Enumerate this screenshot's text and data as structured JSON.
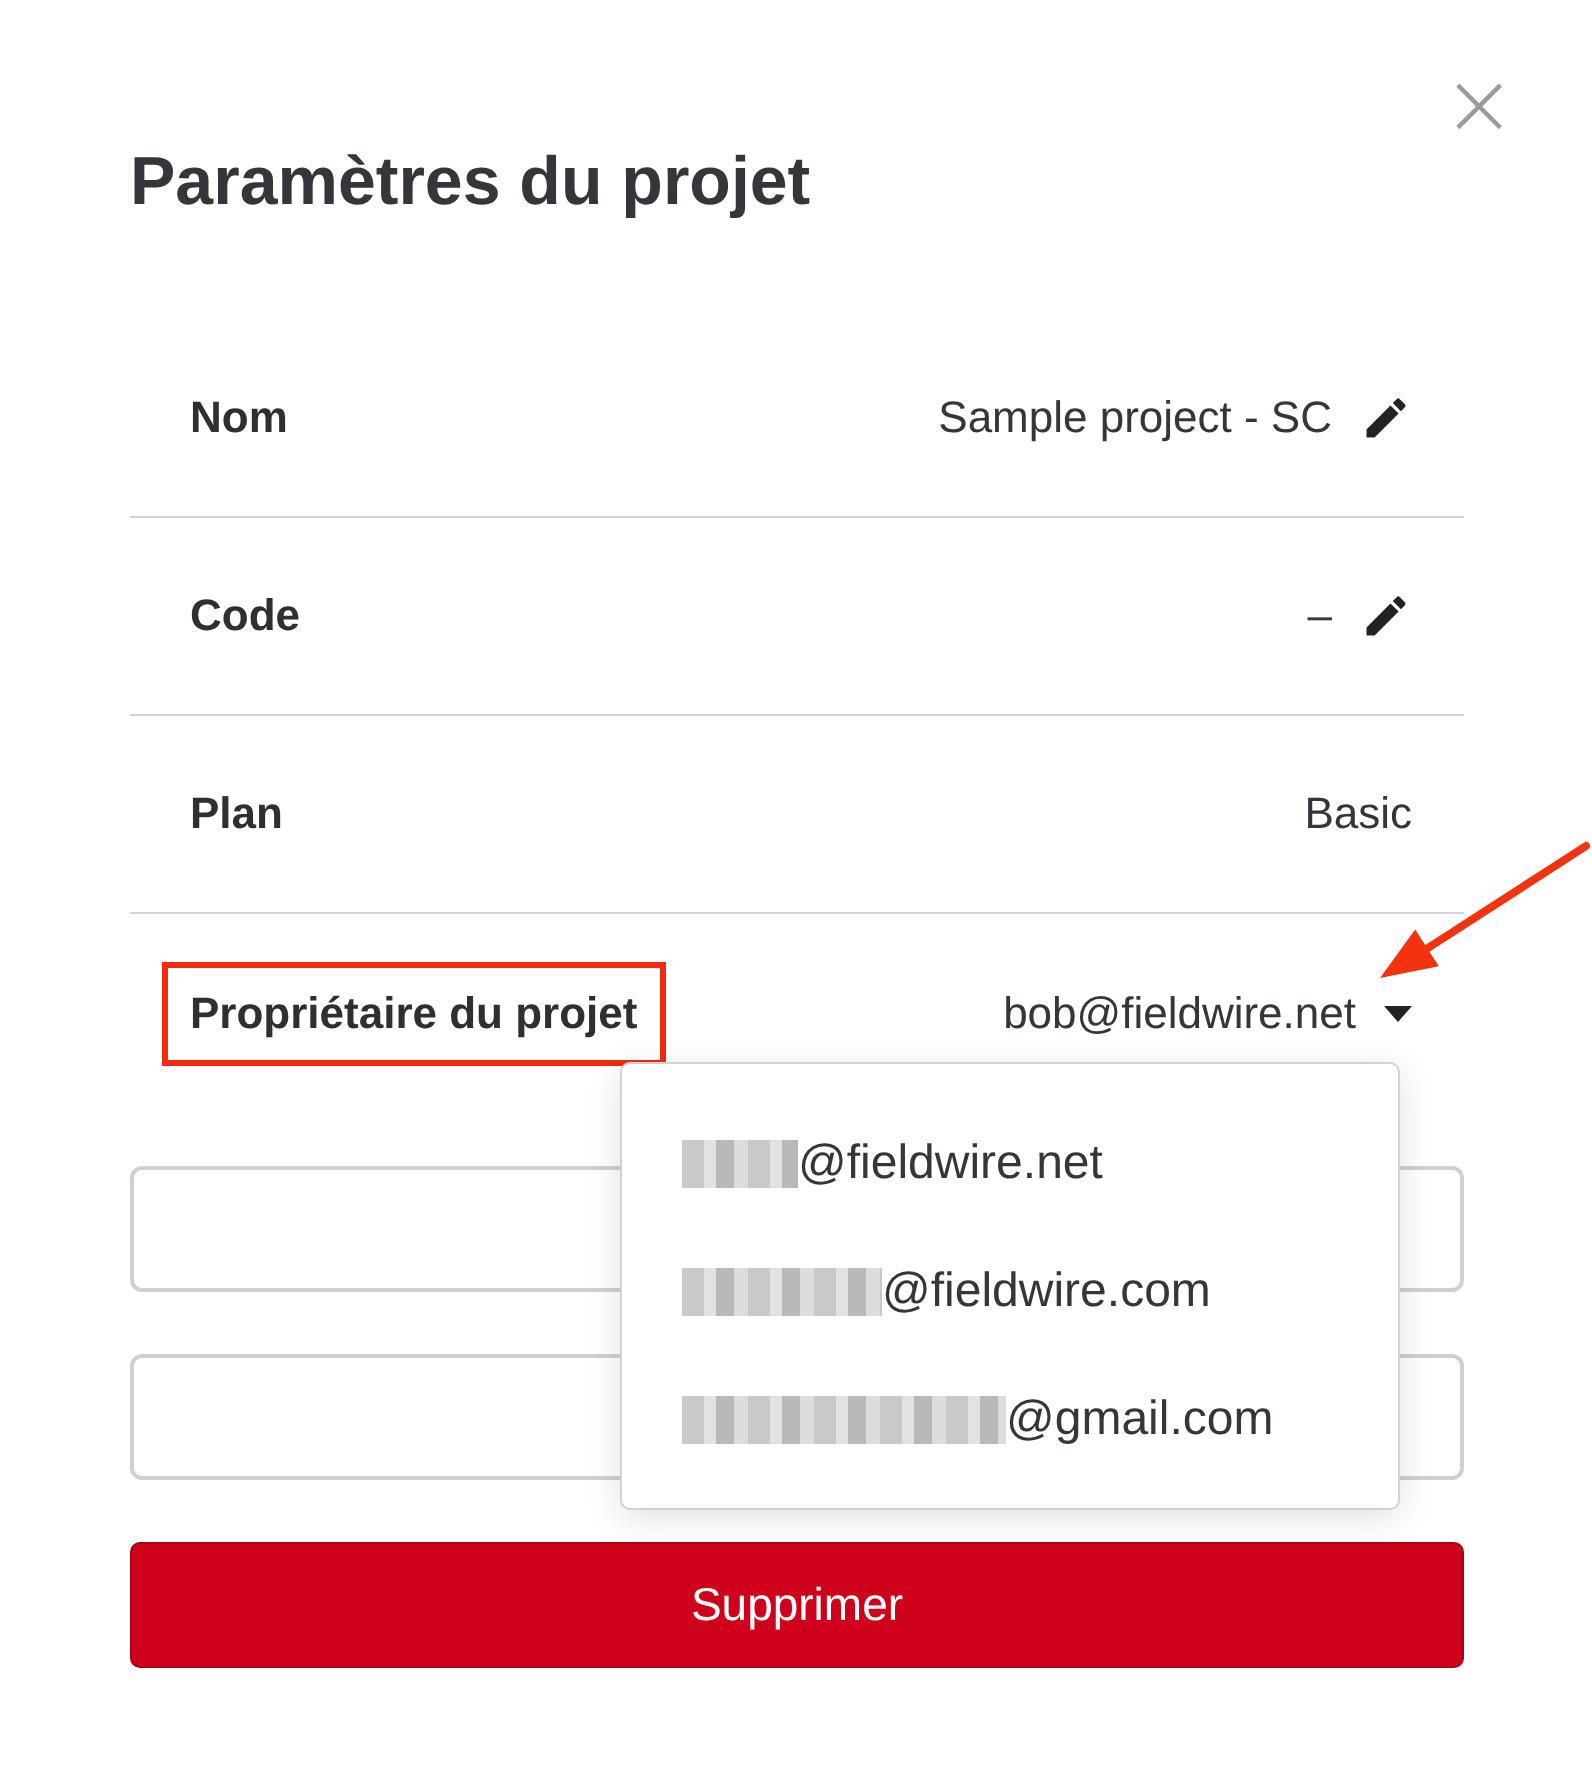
{
  "dialog": {
    "title": "Paramètres du projet",
    "close": "×"
  },
  "rows": [
    {
      "label": "Nom",
      "value": "Sample project - SC",
      "kind": "editable",
      "highlighted": false
    },
    {
      "label": "Code",
      "value": "–",
      "kind": "editable",
      "highlighted": false
    },
    {
      "label": "Plan",
      "value": "Basic",
      "kind": "static",
      "highlighted": false
    },
    {
      "label": "Propriétaire du projet",
      "value": "bob@fieldwire.net",
      "kind": "dropdown",
      "highlighted": true,
      "expanded": true,
      "pointed_by_arrow": true
    }
  ],
  "owner_options": [
    {
      "suffix": "@fieldwire.net"
    },
    {
      "suffix": "@fieldwire.com"
    },
    {
      "suffix": "@gmail.com"
    }
  ],
  "fields": [
    {
      "kind": "input"
    },
    {
      "kind": "input"
    }
  ],
  "delete_button": "Supprimer"
}
